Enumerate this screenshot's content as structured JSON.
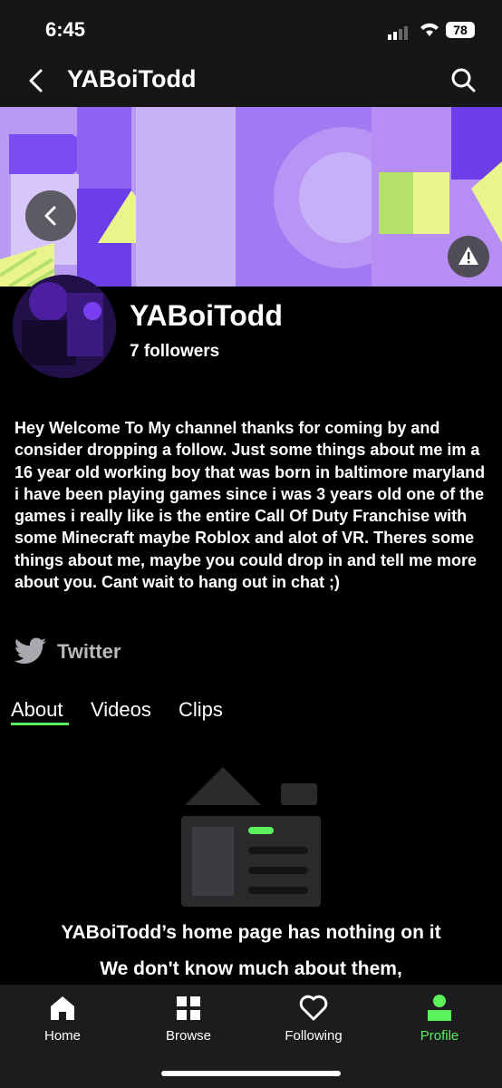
{
  "status_bar": {
    "time": "6:45",
    "battery": "78"
  },
  "header": {
    "title": "YABoiTodd"
  },
  "profile": {
    "name": "YABoiTodd",
    "followers": "7 followers",
    "bio": "Hey Welcome To My channel thanks for coming by and consider dropping a follow.  Just some things about me im a 16 year old working boy that was born in baltimore maryland i have been playing games since i was 3 years old one of the games i really like is the entire Call Of Duty Franchise with some Minecraft maybe Roblox and alot of VR. Theres some things about me, maybe you could drop in and tell me more about you. Cant wait to hang out in chat ;)",
    "social": {
      "label": "Twitter",
      "icon": "twitter-icon"
    }
  },
  "tabs": [
    {
      "label": "About",
      "active": true
    },
    {
      "label": "Videos",
      "active": false
    },
    {
      "label": "Clips",
      "active": false
    }
  ],
  "empty_state": {
    "line1": "YABoiTodd’s home page has nothing on it",
    "line2": "We don't know much about them,"
  },
  "nav": [
    {
      "label": "Home",
      "icon": "home-icon"
    },
    {
      "label": "Browse",
      "icon": "browse-icon"
    },
    {
      "label": "Following",
      "icon": "heart-icon"
    },
    {
      "label": "Profile",
      "icon": "profile-icon",
      "active": true
    }
  ],
  "colors": {
    "accent": "#5cf05c",
    "banner_purple": "#b48cf5",
    "banner_yellow": "#e9f58c"
  }
}
